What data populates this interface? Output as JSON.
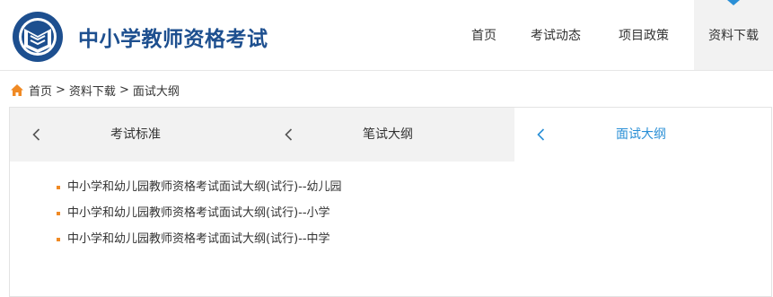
{
  "header": {
    "site_title": "中小学教师资格考试",
    "nav": [
      {
        "label": "首页",
        "active": false
      },
      {
        "label": "考试动态",
        "active": false
      },
      {
        "label": "项目政策",
        "active": false
      },
      {
        "label": "资料下载",
        "active": true
      }
    ]
  },
  "breadcrumb": {
    "items": [
      "首页",
      "资料下载",
      "面试大纲"
    ],
    "separator": ">"
  },
  "tabs": [
    {
      "label": "考试标准",
      "active": false
    },
    {
      "label": "笔试大纲",
      "active": false
    },
    {
      "label": "面试大纲",
      "active": true
    }
  ],
  "documents": [
    "中小学和幼儿园教师资格考试面试大纲(试行)--幼儿园",
    "中小学和幼儿园教师资格考试面试大纲(试行)--小学",
    "中小学和幼儿园教师资格考试面试大纲(试行)--中学"
  ],
  "colors": {
    "brand_blue": "#1d4f8f",
    "accent_blue": "#2a8fd6",
    "accent_orange": "#f08a24",
    "tab_bg": "#f2f2f2"
  },
  "icons": {
    "logo": "exam-logo-icon",
    "home": "home-icon",
    "tab": "chevron-left-icon",
    "nav_active": "caret-down-icon"
  }
}
